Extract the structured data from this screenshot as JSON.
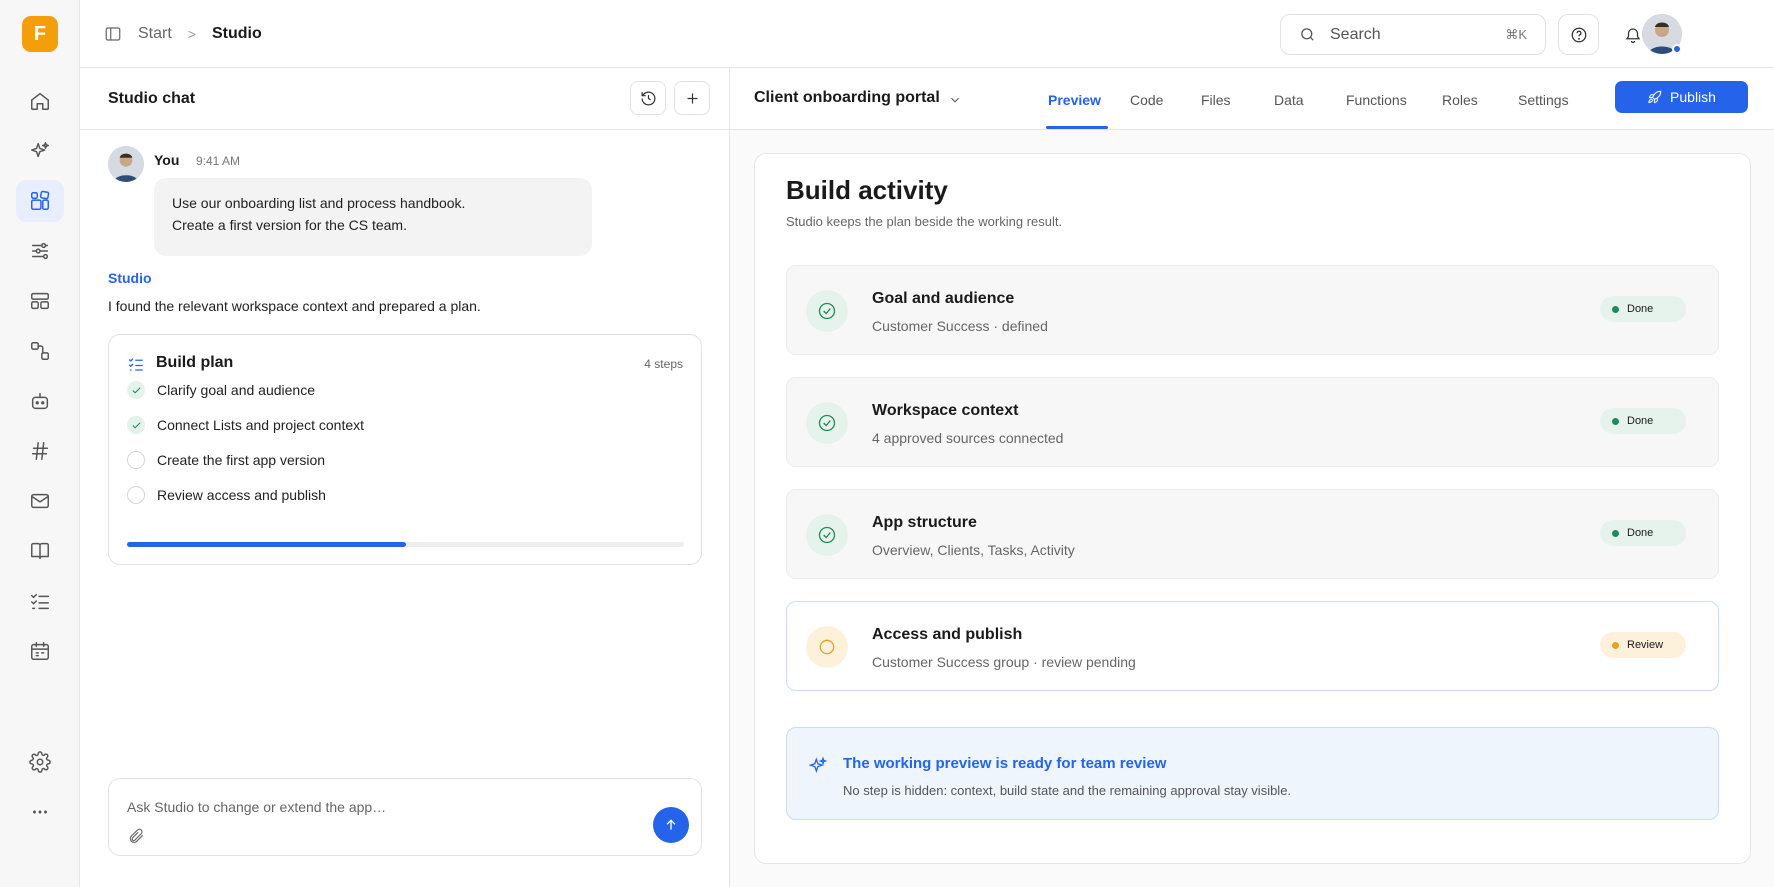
{
  "brand": {
    "logo_letter": "F",
    "accent": "#2563eb",
    "logo_color": "#f59e0b"
  },
  "rail": {
    "items": [
      "home-icon",
      "sparkles-icon",
      "apps-icon",
      "sliders-icon",
      "layout-icon",
      "workflow-icon",
      "bot-icon",
      "hash-icon",
      "mail-icon",
      "book-icon",
      "list-check-icon",
      "calendar-icon"
    ],
    "active": "apps-icon",
    "bottom": [
      "gear-icon",
      "more-icon"
    ]
  },
  "topbar": {
    "breadcrumb": {
      "start": "Start",
      "separator": ">",
      "current": "Studio"
    },
    "search": {
      "placeholder": "Search",
      "shortcut": "⌘K"
    }
  },
  "chat": {
    "title": "Studio chat",
    "user_message": {
      "author": "You",
      "time": "9:41 AM",
      "line1": "Use our onboarding list and process handbook.",
      "line2": "Create a first version for the CS team."
    },
    "studio_reply": {
      "author": "Studio",
      "text": "I found the relevant workspace context and prepared a plan."
    },
    "plan": {
      "title": "Build plan",
      "step_count": "4 steps",
      "steps": [
        {
          "label": "Clarify goal and audience",
          "done": true
        },
        {
          "label": "Connect Lists and project context",
          "done": true
        },
        {
          "label": "Create the first app version",
          "done": false
        },
        {
          "label": "Review access and publish",
          "done": false
        }
      ],
      "progress": 0.5
    },
    "composer": {
      "placeholder": "Ask Studio to change or extend the app…"
    }
  },
  "main": {
    "app_name": "Client onboarding portal",
    "tabs": [
      "Preview",
      "Code",
      "Files",
      "Data",
      "Functions",
      "Roles",
      "Settings"
    ],
    "active_tab": "Preview",
    "publish_label": "Publish",
    "canvas": {
      "title": "Build activity",
      "subtitle": "Studio keeps the plan beside the working result.",
      "cards": [
        {
          "title": "Goal and audience",
          "subtitle": "Customer Success · defined",
          "status": "Done"
        },
        {
          "title": "Workspace context",
          "subtitle": "4 approved sources connected",
          "status": "Done"
        },
        {
          "title": "App structure",
          "subtitle": "Overview, Clients, Tasks, Activity",
          "status": "Done"
        },
        {
          "title": "Access and publish",
          "subtitle": "Customer Success group · review pending",
          "status": "Review"
        }
      ],
      "callout": {
        "title": "The working preview is ready for team review",
        "text": "No step is hidden: context, build state and the remaining approval stay visible."
      }
    }
  }
}
